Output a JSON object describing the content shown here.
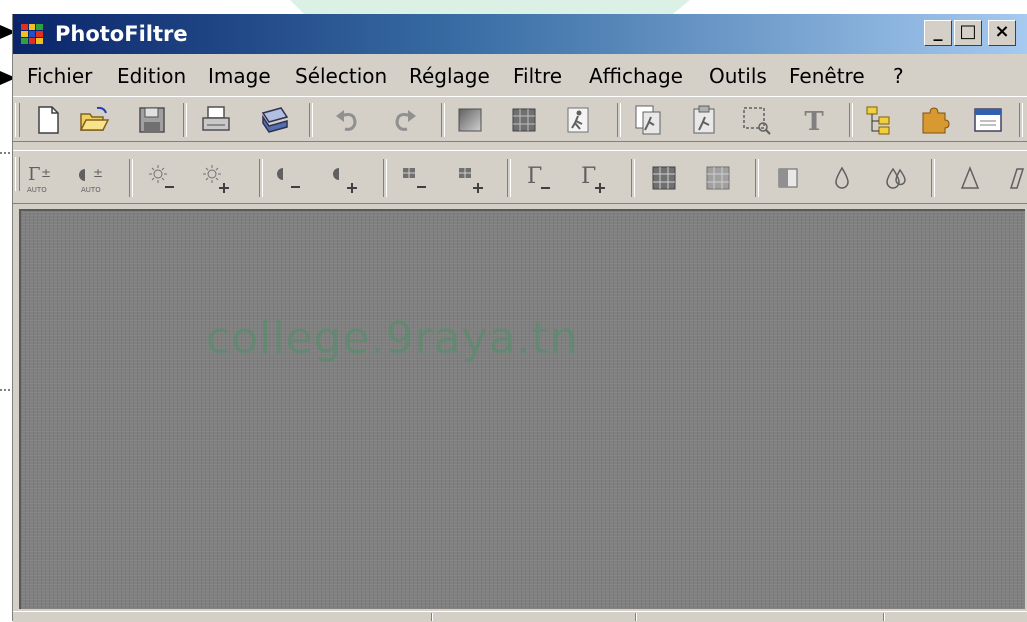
{
  "app": {
    "title": "PhotoFiltre"
  },
  "window_controls": {
    "minimize": "_",
    "maximize": "□",
    "close": "×"
  },
  "menu": {
    "items": [
      "Fichier",
      "Edition",
      "Image",
      "Sélection",
      "Réglage",
      "Filtre",
      "Affichage",
      "Outils",
      "Fenêtre",
      "?"
    ]
  },
  "toolbar1": {
    "icons": [
      "new-document-icon",
      "open-folder-icon",
      "save-disk-icon",
      "print-icon",
      "scan-icon",
      "undo-icon",
      "redo-icon",
      "gradient-icon",
      "grid-icon",
      "run-figure-icon",
      "copy-figure-icon",
      "paste-figure-icon",
      "selection-icon",
      "text-icon",
      "explorer-tree-icon",
      "puzzle-plugin-icon",
      "window-icon"
    ]
  },
  "toolbar2": {
    "auto_label": "AUTO",
    "glyphs": {
      "gamma": "Γ",
      "plusminus": "±",
      "minus": "−",
      "plus": "+"
    }
  },
  "workspace": {
    "watermark": "college.9raya.tn"
  },
  "colors": {
    "titlebar_dark": "#0a246a",
    "titlebar_light": "#a6caf0",
    "chrome": "#d4d0c8",
    "workspace": "#808080"
  }
}
